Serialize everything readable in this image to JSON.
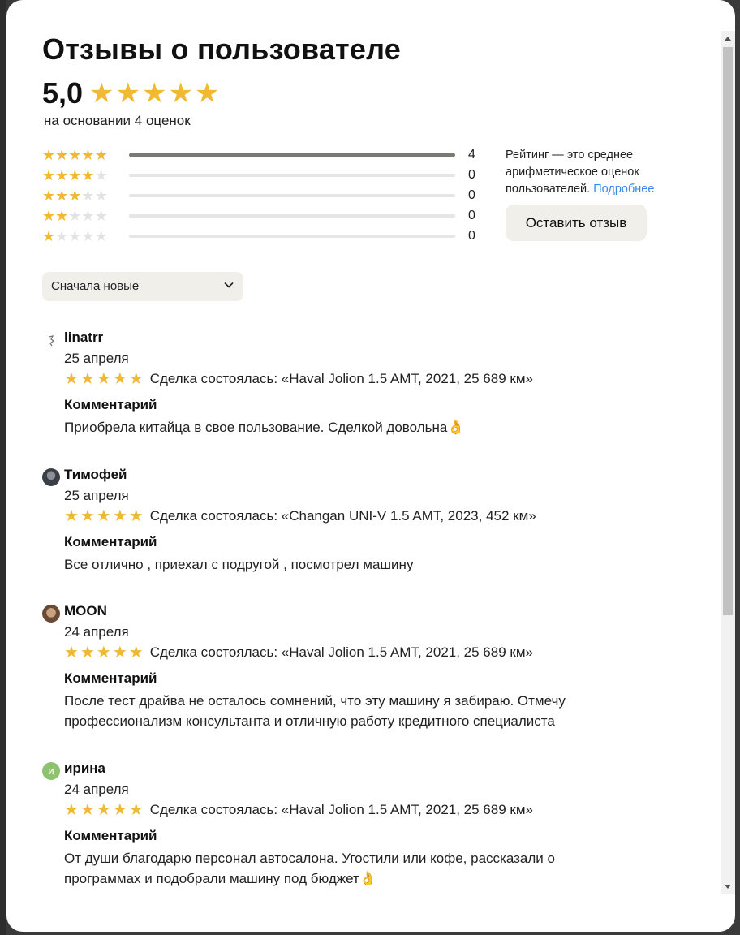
{
  "modal": {
    "title": "Отзывы о пользователе",
    "score": "5,0",
    "basis": "на основании 4 оценок"
  },
  "distribution": [
    {
      "stars": 5,
      "count": "4",
      "fraction": 1.0
    },
    {
      "stars": 4,
      "count": "0",
      "fraction": 0
    },
    {
      "stars": 3,
      "count": "0",
      "fraction": 0
    },
    {
      "stars": 2,
      "count": "0",
      "fraction": 0
    },
    {
      "stars": 1,
      "count": "0",
      "fraction": 0
    }
  ],
  "note": {
    "text": "Рейтинг — это среднее арифметическое оценок пользователей.",
    "link": "Подробнее"
  },
  "leave_review_button": "Оставить отзыв",
  "sort": {
    "selected": "Сначала новые"
  },
  "comment_label": "Комментарий",
  "reviews": [
    {
      "name": "linatrr",
      "date": "25 апреля",
      "rating": 5,
      "deal": "Сделка состоялась: «Haval Jolion 1.5 AMT, 2021, 25 689 км»",
      "text": "Приобрела китайца в свое пользование. Сделкой довольна👌",
      "avatar": "sketch-avatar"
    },
    {
      "name": "Тимофей",
      "date": "25 апреля",
      "rating": 5,
      "deal": "Сделка состоялась: «Changan UNI-V 1.5 AMT, 2023, 452 км»",
      "text": "Все отлично , приехал с подругой , посмотрел машину",
      "avatar": "photo-avatar"
    },
    {
      "name": "MOON",
      "date": "24 апреля",
      "rating": 5,
      "deal": "Сделка состоялась: «Haval Jolion 1.5 AMT, 2021, 25 689 км»",
      "text": "После тест драйва не осталось сомнений, что эту машину я забираю. Отмечу профессионализм консультанта и отличную работу кредитного специалиста",
      "avatar": "photo-avatar"
    },
    {
      "name": "ирина",
      "date": "24 апреля",
      "rating": 5,
      "deal": "Сделка состоялась: «Haval Jolion 1.5 AMT, 2021, 25 689 км»",
      "text": "От души благодарю персонал автосалона. Угостили или кофе, рассказали о программах и подобрали машину под бюджет👌",
      "avatar": "letter-avatar",
      "avatar_letter": "и"
    }
  ],
  "colors": {
    "star": "#f1b933",
    "link": "#3e87ea",
    "button_bg": "#f0efea",
    "letter_avatar": "#8dc26f"
  }
}
